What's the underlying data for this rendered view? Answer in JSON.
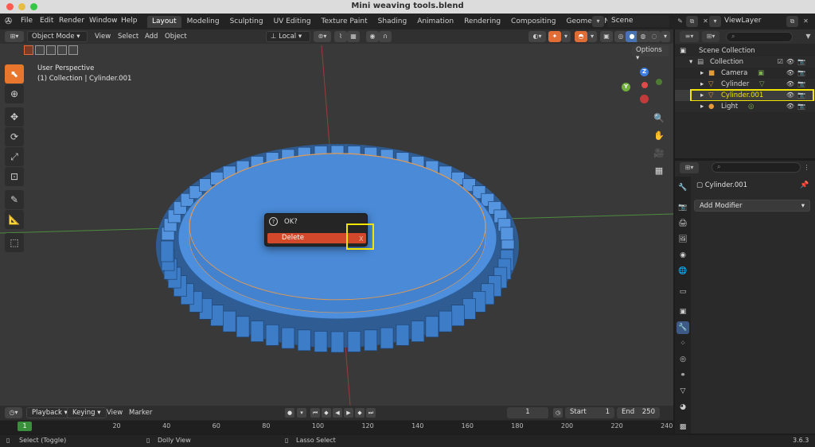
{
  "window": {
    "title": "Mini weaving tools.blend"
  },
  "menu": {
    "file": "File",
    "edit": "Edit",
    "render": "Render",
    "window": "Window",
    "help": "Help"
  },
  "workspaces": [
    {
      "label": "Layout",
      "active": true
    },
    {
      "label": "Modeling"
    },
    {
      "label": "Sculpting"
    },
    {
      "label": "UV Editing"
    },
    {
      "label": "Texture Paint"
    },
    {
      "label": "Shading"
    },
    {
      "label": "Animation"
    },
    {
      "label": "Rendering"
    },
    {
      "label": "Compositing"
    },
    {
      "label": "Geometry Nodes"
    }
  ],
  "scene": {
    "name": "Scene"
  },
  "view_layer": {
    "name": "ViewLayer"
  },
  "viewport": {
    "mode": "Object Mode",
    "menus": {
      "view": "View",
      "select": "Select",
      "add": "Add",
      "object": "Object"
    },
    "transform_orientation": "Local",
    "options_label": "Options",
    "perspective_label": "User Perspective",
    "collection_label": "(1) Collection | Cylinder.001",
    "gizmo": {
      "z": "Z",
      "y": "Y"
    }
  },
  "confirm_popup": {
    "title": "OK?",
    "action_label": "Delete",
    "shortcut_hint": "X",
    "question_icon": "?"
  },
  "outliner": {
    "root": "Scene Collection",
    "collection": "Collection",
    "items": [
      {
        "name": "Camera",
        "icon": "camera-icon"
      },
      {
        "name": "Cylinder",
        "icon": "mesh-icon"
      },
      {
        "name": "Cylinder.001",
        "icon": "mesh-icon",
        "selected": true
      },
      {
        "name": "Light",
        "icon": "light-icon"
      }
    ]
  },
  "properties": {
    "object_name": "Cylinder.001",
    "add_modifier_label": "Add Modifier"
  },
  "timeline": {
    "playback_label": "Playback",
    "keying_label": "Keying",
    "view_label": "View",
    "marker_label": "Marker",
    "current_frame": "1",
    "start_label": "Start",
    "start_value": "1",
    "end_label": "End",
    "end_value": "250",
    "ruler_marks": [
      "20",
      "40",
      "60",
      "80",
      "100",
      "120",
      "140",
      "160",
      "180",
      "200",
      "220",
      "240"
    ],
    "marker_frame": "1"
  },
  "statusbar": {
    "select": "Select (Toggle)",
    "dolly": "Dolly View",
    "lasso": "Lasso Select",
    "version": "3.6.3"
  },
  "colors": {
    "accent_orange": "#e8762c",
    "delete_red": "#d2482a",
    "highlight_yellow": "#f2e600",
    "selected_blue": "#4772b3",
    "mesh_blue": "#4d8fdc"
  }
}
